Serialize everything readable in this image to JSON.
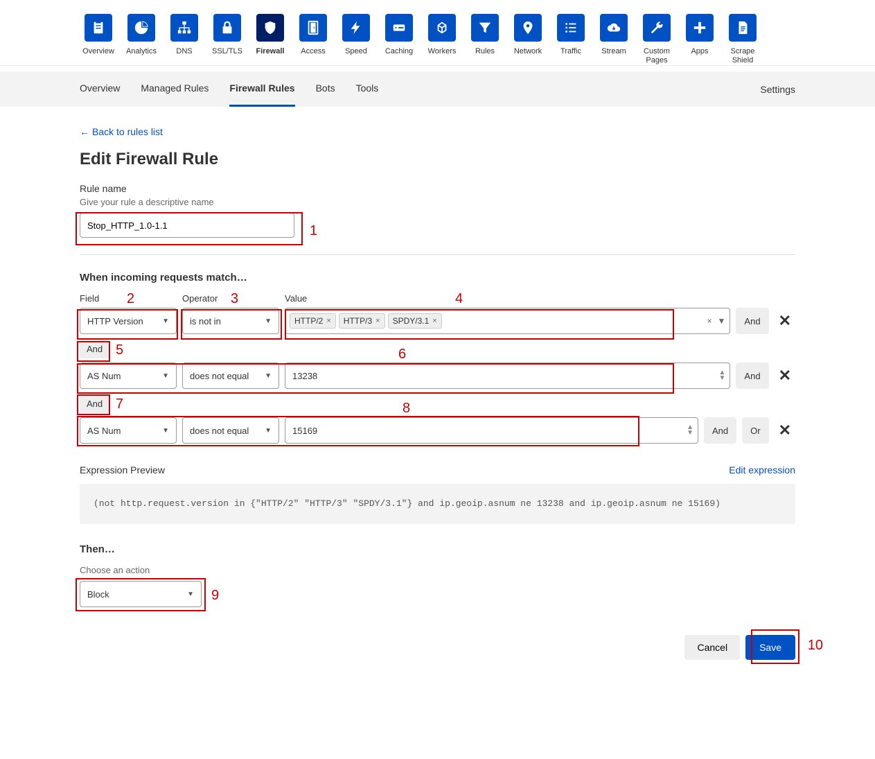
{
  "topnav": [
    {
      "label": "Overview",
      "icon": "clipboard"
    },
    {
      "label": "Analytics",
      "icon": "pie"
    },
    {
      "label": "DNS",
      "icon": "sitemap"
    },
    {
      "label": "SSL/TLS",
      "icon": "lock"
    },
    {
      "label": "Firewall",
      "icon": "shield",
      "active": true
    },
    {
      "label": "Access",
      "icon": "door"
    },
    {
      "label": "Speed",
      "icon": "bolt"
    },
    {
      "label": "Caching",
      "icon": "drive"
    },
    {
      "label": "Workers",
      "icon": "hex"
    },
    {
      "label": "Rules",
      "icon": "funnel"
    },
    {
      "label": "Network",
      "icon": "pin"
    },
    {
      "label": "Traffic",
      "icon": "list"
    },
    {
      "label": "Stream",
      "icon": "cloud"
    },
    {
      "label": "Custom Pages",
      "icon": "wrench"
    },
    {
      "label": "Apps",
      "icon": "plus"
    },
    {
      "label": "Scrape Shield",
      "icon": "doc"
    }
  ],
  "subnav": {
    "tabs": [
      "Overview",
      "Managed Rules",
      "Firewall Rules",
      "Bots",
      "Tools"
    ],
    "active": "Firewall Rules",
    "settings": "Settings"
  },
  "backlink": "Back to rules list",
  "page_title": "Edit Firewall Rule",
  "rule_name": {
    "label": "Rule name",
    "hint": "Give your rule a descriptive name",
    "value": "Stop_HTTP_1.0-1.1"
  },
  "match_section": {
    "title": "When incoming requests match…",
    "headers": {
      "field": "Field",
      "operator": "Operator",
      "value": "Value"
    }
  },
  "rows": [
    {
      "field": "HTTP Version",
      "operator": "is not in",
      "type": "tags",
      "tags": [
        "HTTP/2",
        "HTTP/3",
        "SPDY/3.1"
      ],
      "connector_after": "And",
      "and_btn": true
    },
    {
      "field": "AS Num",
      "operator": "does not equal",
      "type": "number",
      "value": "13238",
      "connector_after": "And",
      "and_btn": true
    },
    {
      "field": "AS Num",
      "operator": "does not equal",
      "type": "number",
      "value": "15169",
      "and_btn": true,
      "or_btn": true
    }
  ],
  "buttons": {
    "and": "And",
    "or": "Or"
  },
  "expression": {
    "label": "Expression Preview",
    "edit": "Edit expression",
    "text": "(not http.request.version in {\"HTTP/2\" \"HTTP/3\" \"SPDY/3.1\"} and ip.geoip.asnum ne 13238 and ip.geoip.asnum ne 15169)"
  },
  "then": {
    "title": "Then…",
    "hint": "Choose an action",
    "value": "Block"
  },
  "footer": {
    "cancel": "Cancel",
    "save": "Save"
  },
  "annotations": [
    "1",
    "2",
    "3",
    "4",
    "5",
    "6",
    "7",
    "8",
    "9",
    "10"
  ]
}
